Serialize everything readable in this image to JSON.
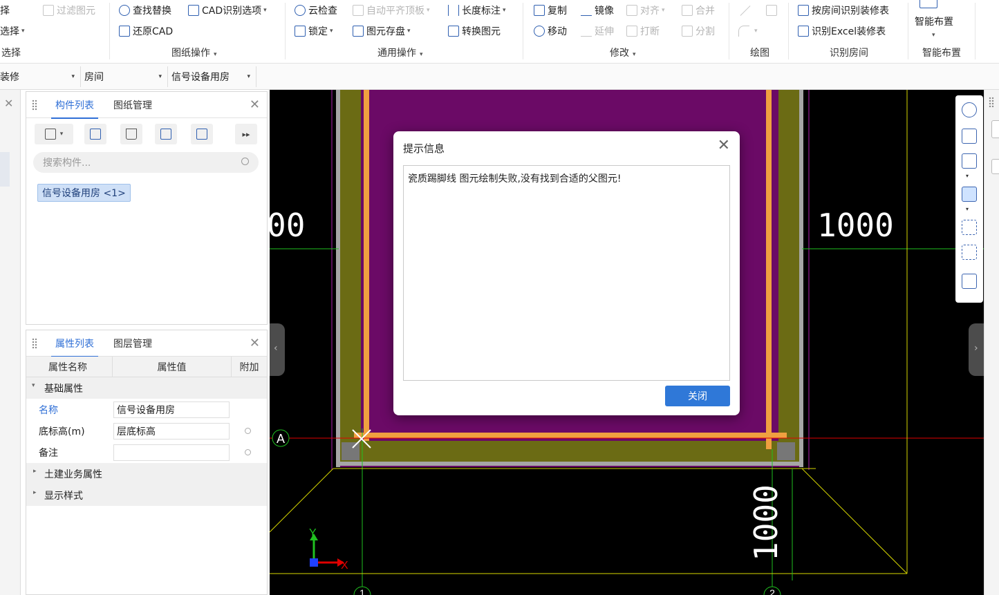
{
  "ribbon": {
    "g1": {
      "item1": "择",
      "item2": "选择",
      "label": "选择"
    },
    "filter": "过滤图元",
    "findreplace": "查找替换",
    "cadopt": "CAD识别选项",
    "restore": "还原CAD",
    "drawing_ops": "图纸操作",
    "cloudcheck": "云检查",
    "autoalign": "自动平齐顶板",
    "dimension": "长度标注",
    "lock": "锁定",
    "elemstore": "图元存盘",
    "convert": "转换图元",
    "common_ops": "通用操作",
    "copy": "复制",
    "mirror": "镜像",
    "align": "对齐",
    "merge": "合并",
    "move": "移动",
    "extend": "延伸",
    "break": "打断",
    "split": "分割",
    "modify": "修改",
    "draw": "绘图",
    "recog_by_room": "按房间识别装修表",
    "recog_excel": "识别Excel装修表",
    "recog_room": "识别房间",
    "smart_layout": "智能布置",
    "smart_layout_group": "智能布置"
  },
  "combobar": {
    "c1": "装修",
    "c2": "房间",
    "c3": "信号设备用房"
  },
  "component_panel": {
    "tab1": "构件列表",
    "tab2": "图纸管理",
    "search_placeholder": "搜索构件...",
    "item": "信号设备用房 <1>"
  },
  "property_panel": {
    "tab1": "属性列表",
    "tab2": "图层管理",
    "col_name": "属性名称",
    "col_value": "属性值",
    "col_extra": "附加",
    "group_basic": "基础属性",
    "rows": [
      {
        "name": "名称",
        "value": "信号设备用房"
      },
      {
        "name": "底标高(m)",
        "value": "层底标高"
      },
      {
        "name": "备注",
        "value": ""
      }
    ],
    "group_civil": "土建业务属性",
    "group_display": "显示样式"
  },
  "canvas": {
    "dim_left": "00",
    "dim_right": "1000",
    "dim_bottom": "1000",
    "axis_a": "A",
    "axis_1": "1",
    "axis_2": "2",
    "x_label": "X",
    "y_label": "Y",
    "colors": {
      "purple": "#6b0a66",
      "olive": "#6b6b14",
      "orange": "#f0a040",
      "grey": "#a6a6a6",
      "green": "#20c020",
      "red": "#e00000",
      "yellow": "#d8d800",
      "magenta": "#b020b0"
    }
  },
  "dialog": {
    "title": "提示信息",
    "message": "瓷质踢脚线 图元绘制失败,没有找到合适的父图元!",
    "close_button": "关闭"
  }
}
